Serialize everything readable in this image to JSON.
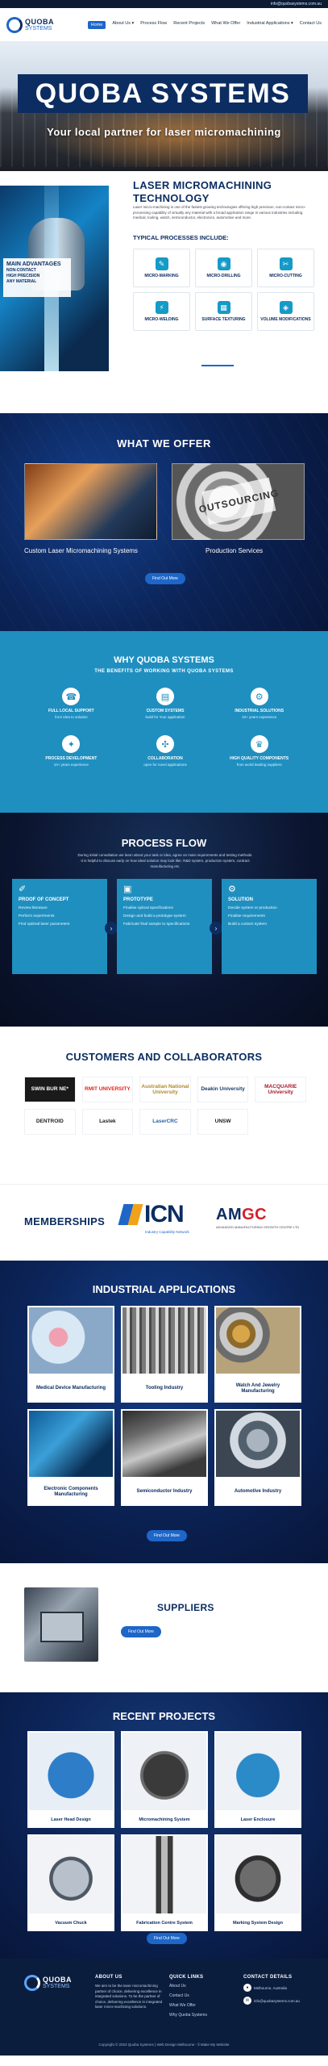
{
  "topbar": {
    "email": "info@quobasystems.com.au"
  },
  "brand": {
    "line1": "QUOBA",
    "line2": "SYSTEMS"
  },
  "nav": [
    {
      "label": "Home"
    },
    {
      "label": "About Us ▾"
    },
    {
      "label": "Process Flow"
    },
    {
      "label": "Recent Projects"
    },
    {
      "label": "What We Offer"
    },
    {
      "label": "Industrial Applications ▾"
    },
    {
      "label": "Contact Us"
    }
  ],
  "hero": {
    "title": "QUOBA SYSTEMS",
    "subtitle": "Your local partner for laser micromachining"
  },
  "laser": {
    "title": "LASER MICROMACHINING TECHNOLOGY",
    "text": "Laser micro-machining is one of the fastest growing technologies offering high precision, non-contact micro-processing capability of virtually any material with a broad application range in various industries including medical, tooling, watch, semiconductor, electronics, automotive and more.",
    "advantages_title": "MAIN ADVANTAGES",
    "advantages": [
      "NON-CONTACT",
      "HIGH PRECISION",
      "ANY MATERIAL"
    ],
    "processes_title": "TYPICAL PROCESSES INCLUDE:",
    "processes": [
      {
        "label": "MICRO-MARKING",
        "icon": "marking-icon"
      },
      {
        "label": "MICRO-DRILLING",
        "icon": "drilling-icon"
      },
      {
        "label": "MICRO-CUTTING",
        "icon": "cutting-icon"
      },
      {
        "label": "MICRO-WELDING",
        "icon": "welding-icon"
      },
      {
        "label": "SURFACE TEXTURING",
        "icon": "texturing-icon"
      },
      {
        "label": "VOLUME MODIFICATIONS",
        "icon": "volume-icon"
      }
    ]
  },
  "offer": {
    "title": "WHAT WE OFFER",
    "card1_caption": "Custom Laser Micromachining Systems",
    "card2_caption": "Production Services",
    "card2_badge": "OUTSOURCING",
    "button": "Find Out More"
  },
  "why": {
    "title": "WHY QUOBA SYSTEMS",
    "subtitle": "THE BENEFITS OF WORKING WITH QUOBA SYSTEMS",
    "items": [
      {
        "title": "FULL LOCAL SUPPORT",
        "desc": "from idea to solution",
        "icon": "support-icon"
      },
      {
        "title": "CUSTOM SYSTEMS",
        "desc": "build for Your application",
        "icon": "custom-icon"
      },
      {
        "title": "INDUSTRIAL SOLUTIONS",
        "desc": "10+ years experience",
        "icon": "industrial-icon"
      },
      {
        "title": "PROCESS DEVELOPMENT",
        "desc": "10+ years experience",
        "icon": "process-icon"
      },
      {
        "title": "COLLABORATION",
        "desc": "open for novel applications",
        "icon": "collaboration-icon"
      },
      {
        "title": "HIGH QUALITY COMPONENTS",
        "desc": "from world leading suppliers",
        "icon": "quality-icon"
      }
    ]
  },
  "flow": {
    "title": "PROCESS FLOW",
    "intro": "During initial consultation we learn about your task or idea, agree on main requirements and testing methods. It is helpful to discuss early on how ideal solution may look like. R&D system, production system, contract manufacturing etc.",
    "steps": [
      {
        "title": "PROOF OF CONCEPT",
        "items": [
          "Review literature",
          "Perform experiments",
          "Find optimal laser parameters"
        ]
      },
      {
        "title": "PROTOTYPE",
        "items": [
          "Finalise optical specifications",
          "Design and build a prototype system",
          "Fabricate final sample to specifications"
        ]
      },
      {
        "title": "SOLUTION",
        "items": [
          "Decide system or production",
          "Finalise requirements",
          "Build a custom system"
        ]
      }
    ]
  },
  "customers": {
    "title": "CUSTOMERS AND COLLABORATORS",
    "logos": [
      {
        "name": "SWIN BUR NE*",
        "color": "#e2231a"
      },
      {
        "name": "RMIT UNIVERSITY",
        "color": "#e2231a"
      },
      {
        "name": "Australian National University",
        "color": "#b08a2e"
      },
      {
        "name": "Deakin University",
        "color": "#1a3a6b"
      },
      {
        "name": "MACQUARIE University",
        "color": "#a6192e"
      },
      {
        "name": "DENTROID",
        "color": "#222222"
      },
      {
        "name": "Lastek",
        "color": "#1a1a1a"
      },
      {
        "name": "LaserCRC",
        "color": "#2b5fa6"
      },
      {
        "name": "UNSW",
        "color": "#1a1a1a"
      }
    ]
  },
  "memberships": {
    "title": "MEMBERSHIPS",
    "icn": {
      "name": "ICN",
      "sub": "Industry Capability Network"
    },
    "amgc": {
      "name_a": "AM",
      "name_b": "GC",
      "sub": "ADVANCED MANUFACTURING GROWTH CENTRE LTD"
    }
  },
  "applications": {
    "title": "INDUSTRIAL APPLICATIONS",
    "items": [
      "Medical Device Manufacturing",
      "Tooling Industry",
      "Watch And Jewelry Manufacturing",
      "Electronic Components Manufacturing",
      "Semiconductor Industry",
      "Automotive Industry"
    ],
    "button": "Find Out More"
  },
  "suppliers": {
    "title": "SUPPLIERS",
    "button": "Find Out More"
  },
  "projects": {
    "title": "RECENT PROJECTS",
    "items": [
      "Laser Head Design",
      "Micromachining System",
      "Laser Enclosure",
      "Vacuum Chuck",
      "Fabrication Centre System",
      "Marking System Design"
    ],
    "button": "Find Out More"
  },
  "footer": {
    "about_title": "ABOUT US",
    "about_text": "We aim to be the laser micromachining partner of choice, delivering excellence in integrated solutions. To be the partner of choice, delivering excellence in integrated laser micro-machining solutions.",
    "links_title": "QUICK LINKS",
    "links": [
      "About Us",
      "Contact Us",
      "What We Offer",
      "Why Quoba Systems"
    ],
    "contact_title": "CONTACT DETAILS",
    "contact": [
      {
        "text": "Melbourne, Australia",
        "icon": "location-icon"
      },
      {
        "text": "info@quobasystems.com.au",
        "icon": "mail-icon"
      }
    ],
    "copyright": "Copyright © 2023 Quoba Systems | Web Design Melbourne - ʬ Make My Website"
  }
}
